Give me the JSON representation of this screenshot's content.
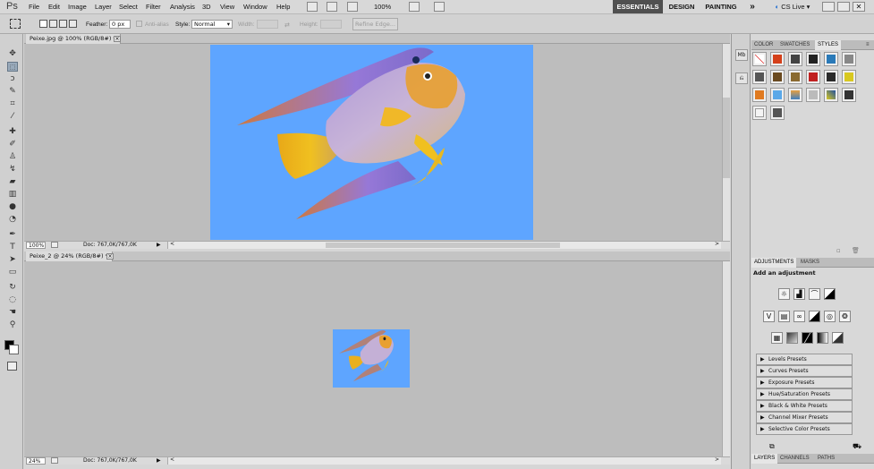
{
  "app": {
    "logo": "Ps"
  },
  "menu": {
    "items": [
      "File",
      "Edit",
      "Image",
      "Layer",
      "Select",
      "Filter",
      "Analysis",
      "3D",
      "View",
      "Window",
      "Help"
    ],
    "zoom": "100%"
  },
  "workspaces": {
    "essentials": "ESSENTIALS",
    "design": "DESIGN",
    "painting": "PAINTING",
    "more": "»",
    "cslive": "CS Live"
  },
  "options": {
    "feather_label": "Feather:",
    "feather_value": "0 px",
    "antialias_label": "Anti-alias",
    "style_label": "Style:",
    "style_value": "Normal",
    "width_label": "Width:",
    "height_label": "Height:",
    "refine_edge": "Refine Edge..."
  },
  "documents": [
    {
      "tab_title": "Peixe.jpg @ 100% (RGB/8#) *",
      "zoom": "100%",
      "doc_info": "Doc: 767,0K/767,0K"
    },
    {
      "tab_title": "Peixe_2 @ 24% (RGB/8#) *",
      "zoom": "24%",
      "doc_info": "Doc: 767,0K/767,0K"
    }
  ],
  "panels": {
    "top_tabs": [
      "COLOR",
      "SWATCHES",
      "STYLES"
    ],
    "adjustments_tabs": [
      "ADJUSTMENTS",
      "MASKS"
    ],
    "add_adjustment": "Add an adjustment",
    "presets": [
      "Levels Presets",
      "Curves Presets",
      "Exposure Presets",
      "Hue/Saturation Presets",
      "Black & White Presets",
      "Channel Mixer Presets",
      "Selective Color Presets"
    ],
    "bottom_tabs": [
      "LAYERS",
      "CHANNELS",
      "PATHS"
    ]
  },
  "colors": {
    "canvas_bg": "#5ea5ff",
    "workspace_active": "#505050"
  }
}
